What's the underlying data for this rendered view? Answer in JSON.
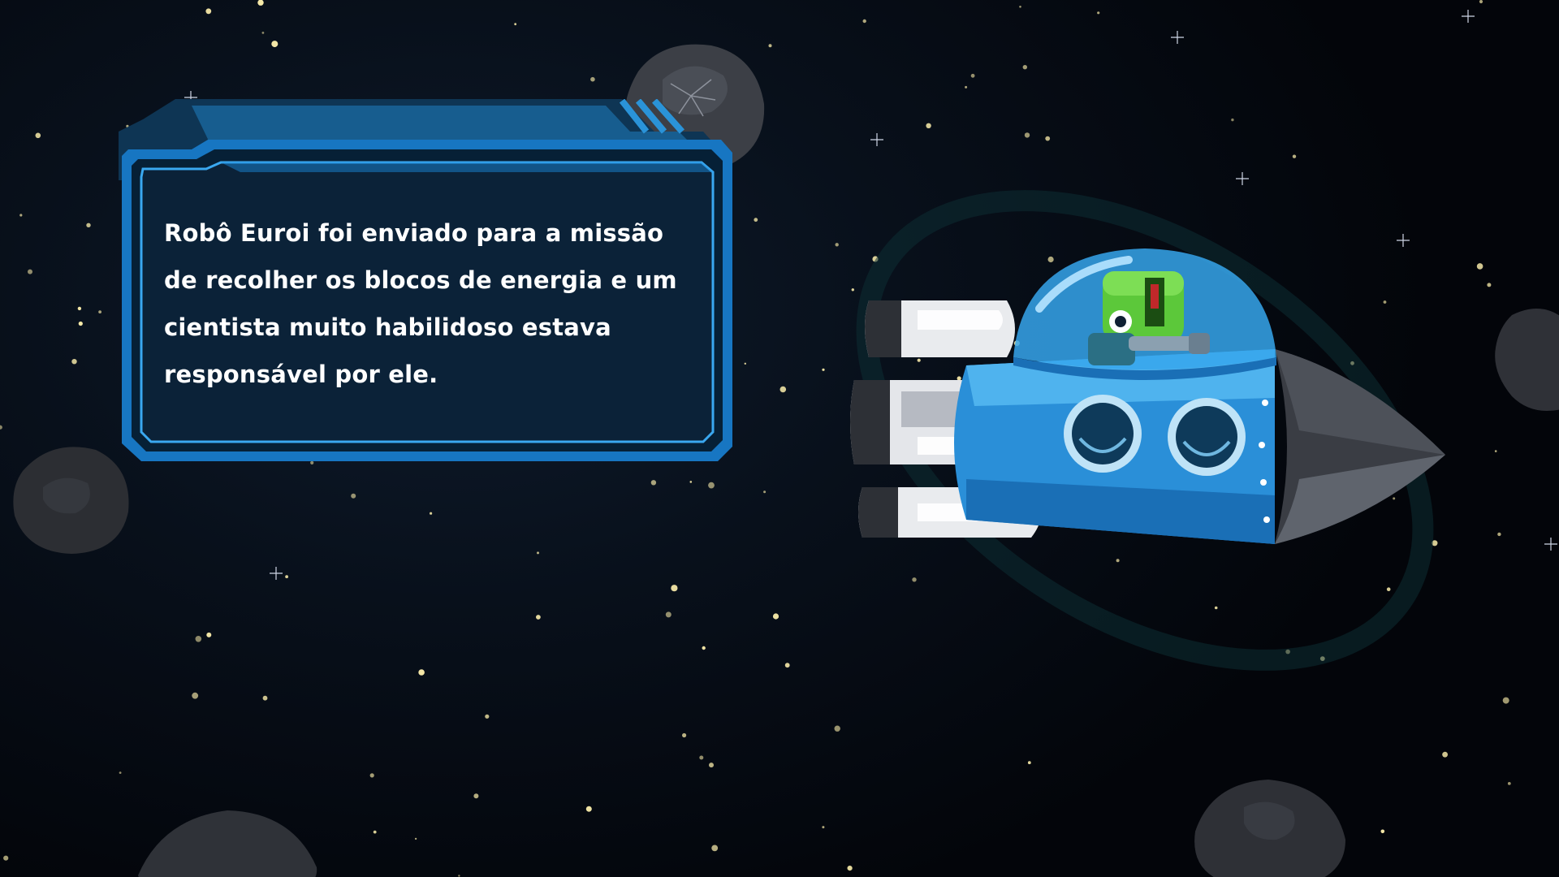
{
  "story": {
    "narration": "Robô Euroi foi enviado para a missão de recolher os blocos de energia e um cientista muito habilidoso estava responsável por ele."
  },
  "colors": {
    "space_bg": "#05070d",
    "panel_fill": "#0b2238",
    "panel_border": "#1a86d6",
    "panel_border_light": "#3aa8f0",
    "ship_body": "#2a8fd8",
    "ship_nose": "#3a3d44",
    "star": "#f6e9a8"
  },
  "icons": {
    "ship": "spaceship-icon",
    "robot": "robot-pilot-icon",
    "asteroid": "asteroid-icon"
  }
}
